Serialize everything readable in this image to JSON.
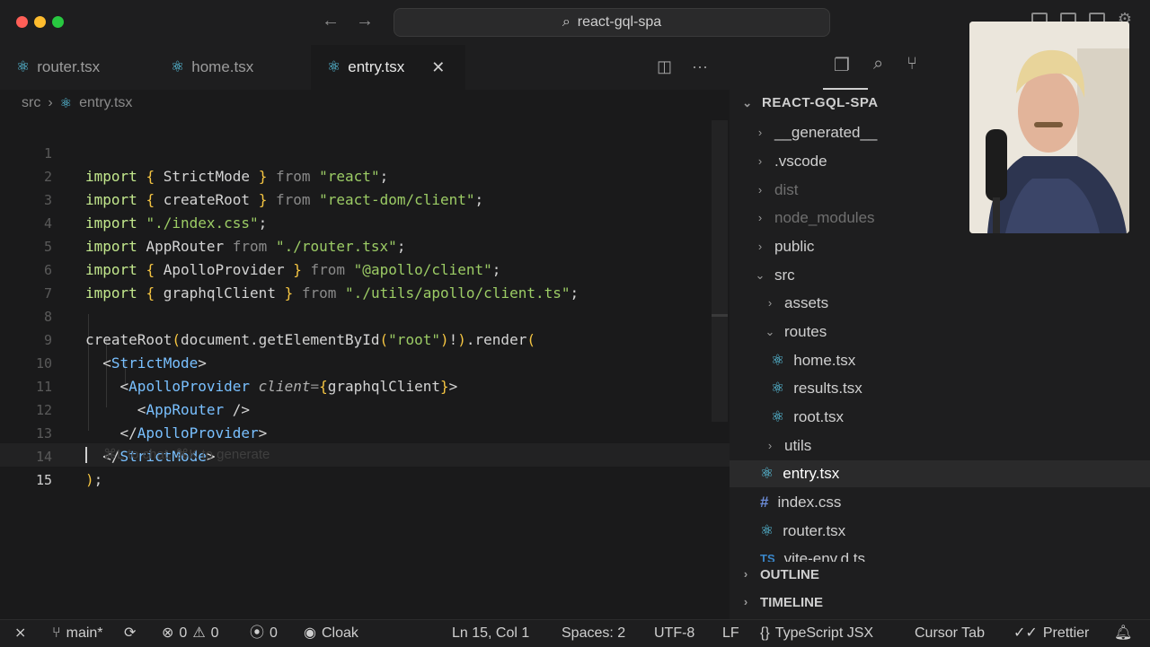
{
  "window": {
    "command_center": "react-gql-spa"
  },
  "tabs": [
    {
      "label": "router.tsx"
    },
    {
      "label": "home.tsx"
    },
    {
      "label": "entry.tsx"
    }
  ],
  "breadcrumb": {
    "folder": "src",
    "file": "entry.tsx"
  },
  "editor": {
    "line_numbers": [
      "1",
      "2",
      "3",
      "4",
      "5",
      "6",
      "7",
      "8",
      "9",
      "10",
      "11",
      "12",
      "13",
      "14",
      "15"
    ],
    "hint": "⌘L to chat, ⌘K to generate",
    "tokens": {
      "import": "import",
      "from": "from",
      "l1_name": "StrictMode",
      "l1_src": "\"react\"",
      "l2_name": "createRoot",
      "l2_src": "\"react-dom/client\"",
      "l3_src": "\"./index.css\"",
      "l4_name": "AppRouter",
      "l4_src": "\"./router.tsx\"",
      "l5_name": "ApolloProvider",
      "l5_src": "\"@apollo/client\"",
      "l6_name": "graphqlClient",
      "l6_src": "\"./utils/apollo/client.ts\"",
      "l8_fn": "createRoot",
      "l8_obj": "document",
      "l8_method": "getElementById",
      "l8_arg": "\"root\"",
      "l8_render": "render",
      "l9_tag": "StrictMode",
      "l10_tag": "ApolloProvider",
      "l10_attr": "client",
      "l10_val": "graphqlClient",
      "l11_tag": "AppRouter",
      "l12_tag": "ApolloProvider",
      "l13_tag": "StrictMode"
    }
  },
  "explorer": {
    "root": "REACT-GQL-SPA",
    "items": [
      {
        "label": "__generated__"
      },
      {
        "label": ".vscode"
      },
      {
        "label": "dist"
      },
      {
        "label": "node_modules"
      },
      {
        "label": "public"
      },
      {
        "label": "src"
      },
      {
        "label": "assets"
      },
      {
        "label": "routes"
      },
      {
        "label": "home.tsx"
      },
      {
        "label": "results.tsx"
      },
      {
        "label": "root.tsx"
      },
      {
        "label": "utils"
      },
      {
        "label": "entry.tsx"
      },
      {
        "label": "index.css"
      },
      {
        "label": "router.tsx"
      },
      {
        "label": "vite-env.d.ts"
      }
    ],
    "ts_badge": "TS",
    "outline": "OUTLINE",
    "timeline": "TIMELINE"
  },
  "status": {
    "branch": "main*",
    "errors": "0",
    "warnings": "0",
    "ports": "0",
    "cloak": "Cloak",
    "position": "Ln 15, Col 1",
    "spaces": "Spaces: 2",
    "encoding": "UTF-8",
    "eol": "LF",
    "language": "TypeScript JSX",
    "cursor_tab": "Cursor Tab",
    "prettier": "Prettier"
  },
  "colors": {
    "accent_react": "#61dafb",
    "string": "#b8d4a0",
    "keyword": "#82aaff"
  }
}
